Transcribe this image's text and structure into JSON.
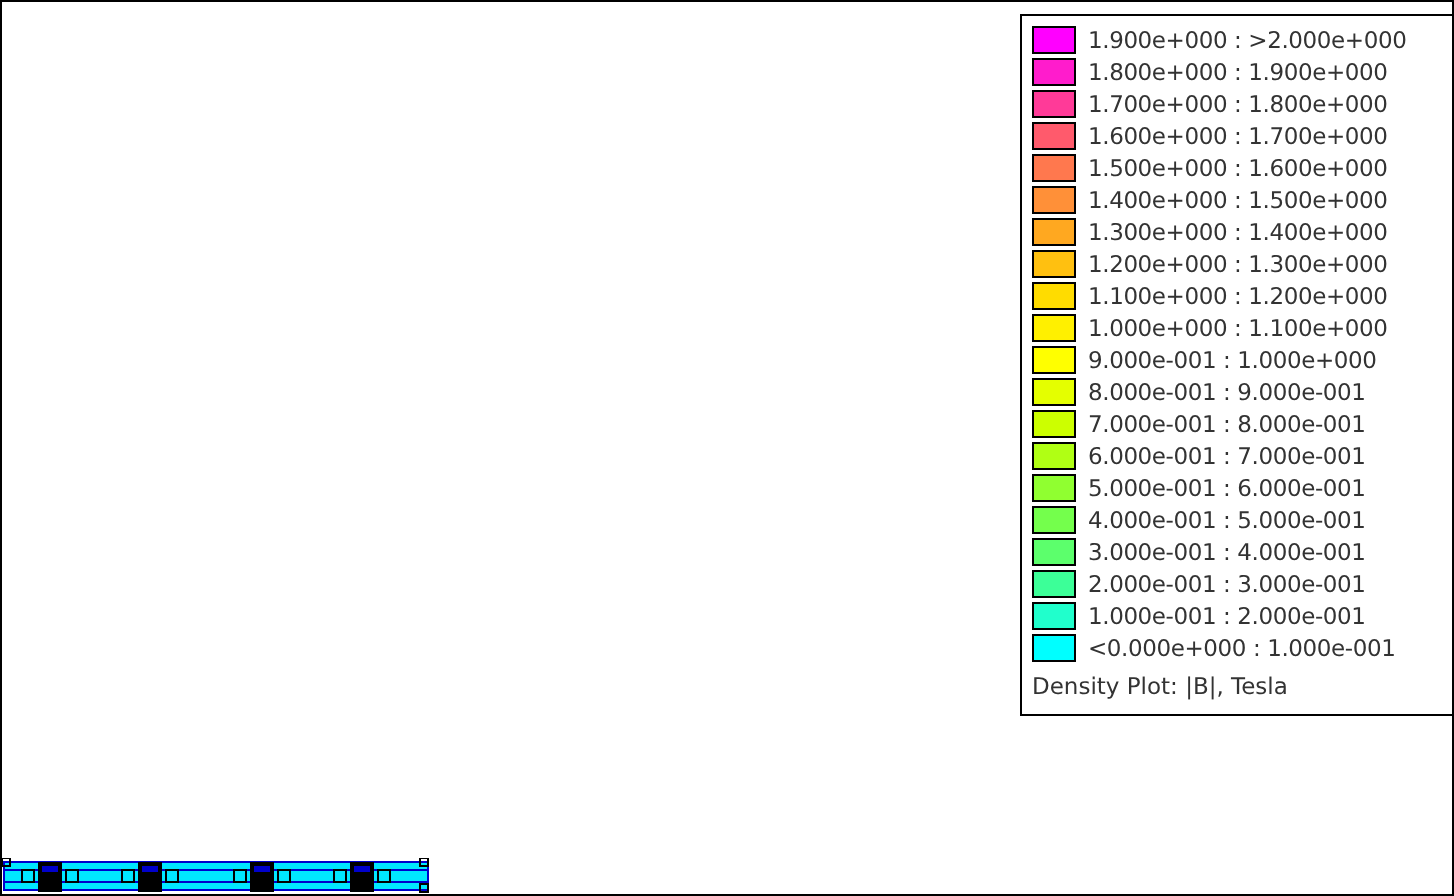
{
  "legend": {
    "entries": [
      {
        "label": "1.900e+000 : >2.000e+000",
        "color": "#ff00ff"
      },
      {
        "label": "1.800e+000 : 1.900e+000",
        "color": "#ff1ccc"
      },
      {
        "label": "1.700e+000 : 1.800e+000",
        "color": "#ff3a98"
      },
      {
        "label": "1.600e+000 : 1.700e+000",
        "color": "#ff5a6c"
      },
      {
        "label": "1.500e+000 : 1.600e+000",
        "color": "#ff784e"
      },
      {
        "label": "1.400e+000 : 1.500e+000",
        "color": "#ff9038"
      },
      {
        "label": "1.300e+000 : 1.400e+000",
        "color": "#ffa820"
      },
      {
        "label": "1.200e+000 : 1.300e+000",
        "color": "#ffc010"
      },
      {
        "label": "1.100e+000 : 1.200e+000",
        "color": "#ffdc00"
      },
      {
        "label": "1.000e+000 : 1.100e+000",
        "color": "#fff000"
      },
      {
        "label": "9.000e-001 : 1.000e+000",
        "color": "#ffff00"
      },
      {
        "label": "8.000e-001 : 9.000e-001",
        "color": "#e4ff00"
      },
      {
        "label": "7.000e-001 : 8.000e-001",
        "color": "#ccff00"
      },
      {
        "label": "6.000e-001 : 7.000e-001",
        "color": "#b0ff14"
      },
      {
        "label": "5.000e-001 : 6.000e-001",
        "color": "#90ff30"
      },
      {
        "label": "4.000e-001 : 5.000e-001",
        "color": "#74ff4c"
      },
      {
        "label": "3.000e-001 : 4.000e-001",
        "color": "#5cff6c"
      },
      {
        "label": "2.000e-001 : 3.000e-001",
        "color": "#3cff98"
      },
      {
        "label": "1.000e-001 : 2.000e-001",
        "color": "#20ffcc"
      },
      {
        "label": "<0.000e+000 : 1.000e-001",
        "color": "#00ffff"
      }
    ],
    "title": "Density Plot: |B|, Tesla"
  }
}
